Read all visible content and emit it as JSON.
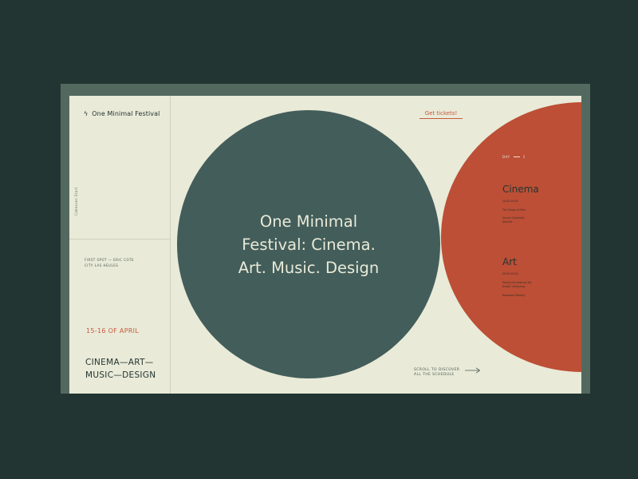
{
  "brand": {
    "name": "One Minimal Festival",
    "icon": "lightning-bolt-icon"
  },
  "sidebar": {
    "vertical_text": "Cabasses Start",
    "address": [
      "FIRST SPOT — ERIC COTE",
      "CITY LAS HEULES"
    ],
    "date": "15-16 OF APRIL",
    "tagline": [
      "CINEMA—ART—",
      "MUSIC—DESIGN"
    ]
  },
  "hero": {
    "lines": [
      "One Minimal",
      "Festival: Cinema.",
      "Art. Music. Design"
    ]
  },
  "cta": {
    "tickets_label": "Get tickets!"
  },
  "schedule": {
    "day_label": "DAY",
    "day_number": "1",
    "sections": [
      {
        "title": "Cinema",
        "lines": [
          "20:00-00:00",
          "The Shape of Fear",
          "Ascent Cinematic",
          "Afterlife"
        ]
      },
      {
        "title": "Art",
        "lines": [
          "00:00-03:00",
          "Facing the Abstract Art",
          "Artists' Gathering",
          "Reseason Meetup"
        ]
      }
    ]
  },
  "scroll": {
    "lines": [
      "SCROLL TO DISCOVER",
      "ALL THE SCHEDULE"
    ]
  },
  "colors": {
    "background": "#233532",
    "panel": "#e9ead8",
    "teal_circle": "#435d5a",
    "red_circle": "#bc4f36",
    "accent": "#c65a3d",
    "ink": "#233532"
  }
}
